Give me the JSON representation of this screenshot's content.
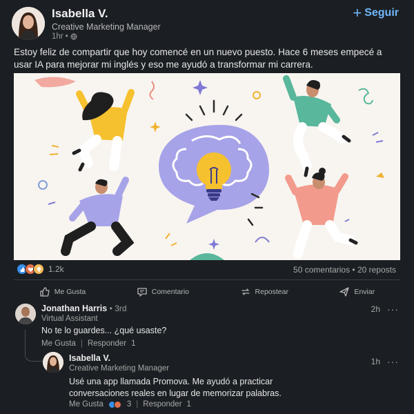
{
  "post": {
    "author_name": "Isabella V.",
    "author_title": "Creative Marketing Manager",
    "time": "1hr",
    "time_sep": "•",
    "follow_label": "Seguir",
    "follow_plus": "+",
    "text": "Estoy feliz de compartir que hoy comencé en un nuevo puesto. Hace 6 meses empecé a usar IA para mejorar mi inglés y eso me ayudó a transformar mi carrera.",
    "reaction_count": "1.2k",
    "comments_reposts": "50 comentarios • 20 reposts"
  },
  "actions": [
    {
      "label": "Me Gusta",
      "icon": "thumbs-up-icon"
    },
    {
      "label": "Comentario",
      "icon": "comment-icon"
    },
    {
      "label": "Repostear",
      "icon": "repost-icon"
    },
    {
      "label": "Enviar",
      "icon": "send-icon"
    }
  ],
  "comments": [
    {
      "name": "Jonathan Harris",
      "degree": "• 3rd",
      "title": "Virtual Assistant",
      "time": "2h",
      "more": "···",
      "text": "No te lo guardes... ¿qué usaste?",
      "like_label": "Me Gusta",
      "sep": "|",
      "reply_label": "Responder",
      "reply_count": "1"
    },
    {
      "name": "Isabella V.",
      "title": "Creative Marketing Manager",
      "time": "1h",
      "more": "···",
      "text_line1": "Usé una app llamada Promova. Me ayudó a practicar",
      "text_line2": "conversaciones reales en lugar de memorizar palabras.",
      "like_label": "Me Gusta",
      "like_count": "3",
      "sep": "|",
      "reply_label": "Responder",
      "reply_count": "1"
    }
  ],
  "colors": {
    "background": "#1b1f23",
    "accent": "#71b7fb",
    "image_bg": "#f8f5f0",
    "bubble": "#a7a3e8",
    "bulb": "#f6c12f"
  }
}
